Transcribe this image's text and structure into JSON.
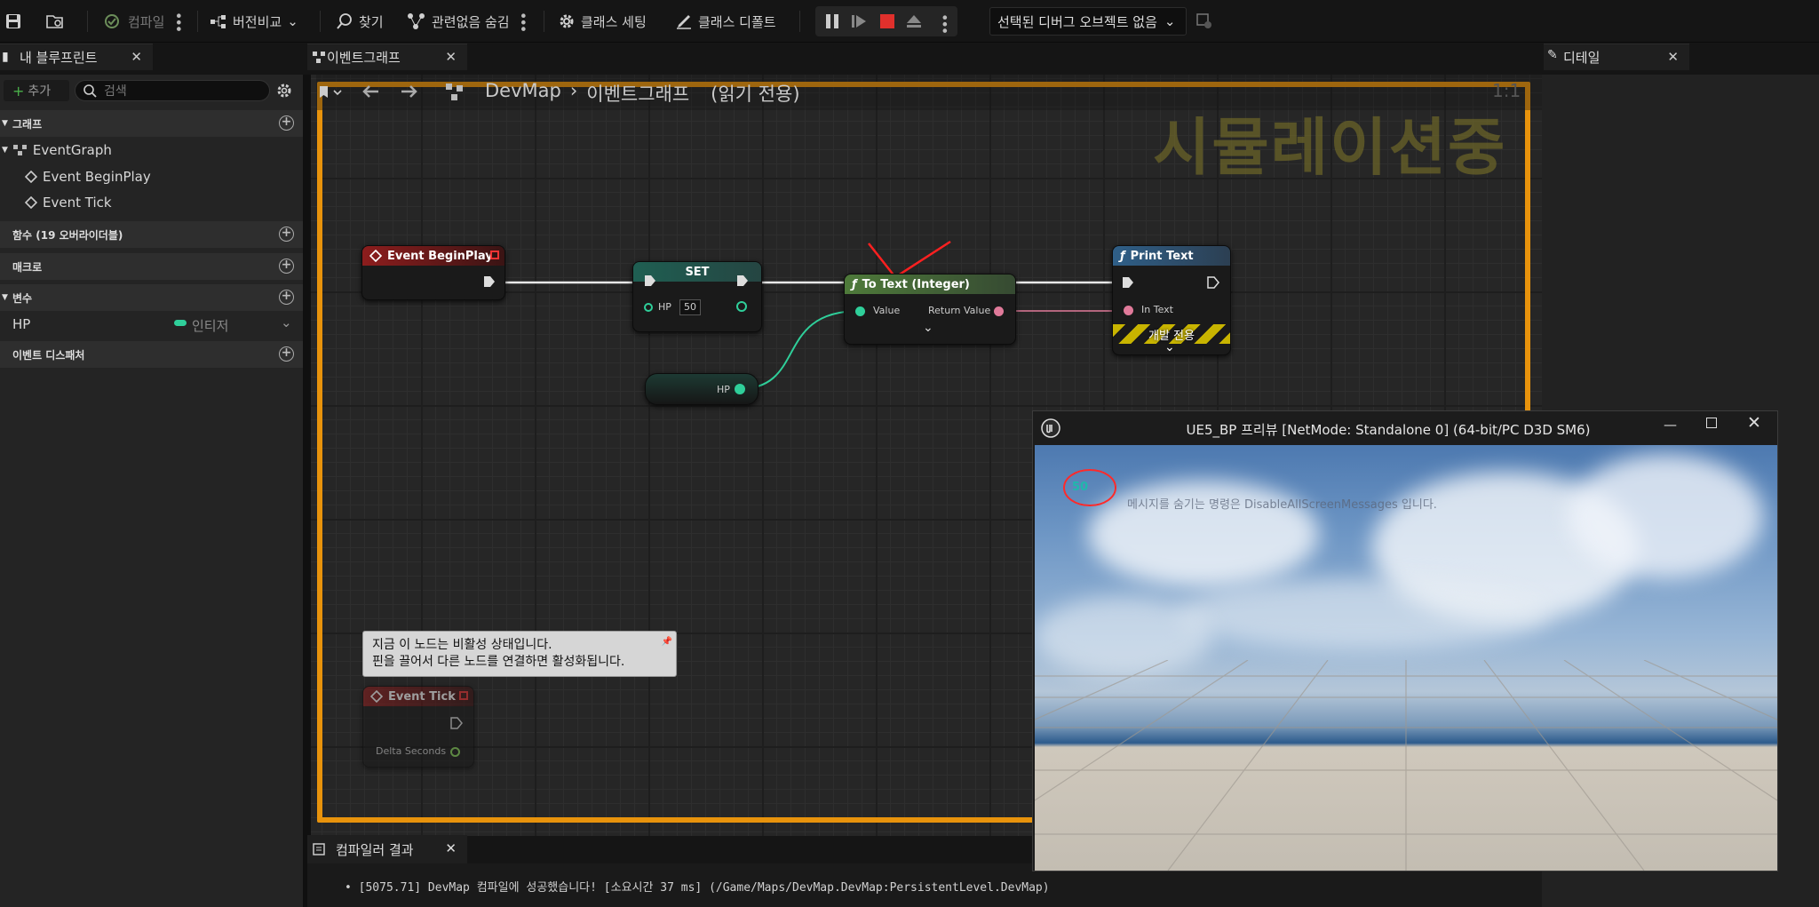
{
  "toolbar": {
    "compile": "컴파일",
    "diff": "버전비교",
    "find": "찾기",
    "hide_unrelated": "관련없음 숨김",
    "class_settings": "클래스 세팅",
    "class_defaults": "클래스 디폴트",
    "debug_object": "선택된 디버그 오브젝트 없음"
  },
  "my_blueprint": {
    "tab": "내 블루프린트",
    "add": "추가",
    "search_placeholder": "검색",
    "sections": {
      "graphs": "그래프",
      "functions": "함수 (19 오버라이더블)",
      "macros": "매크로",
      "variables": "변수",
      "dispatchers": "이벤트 디스패처"
    },
    "graph_items": [
      "EventGraph",
      "Event BeginPlay",
      "Event Tick"
    ],
    "variable": {
      "name": "HP",
      "type": "인티저"
    }
  },
  "graph": {
    "tab": "이벤트그래프",
    "breadcrumb_map": "DevMap",
    "breadcrumb_graph": "이벤트그래프",
    "readonly": "(읽기 전용)",
    "simulating": "시뮬레이션중",
    "zoom": "1:1",
    "nodes": {
      "begin_play": "Event BeginPlay",
      "set": "SET",
      "set_pin": "HP",
      "set_value": "50",
      "get_hp": "HP",
      "to_text": "To Text (Integer)",
      "to_text_in": "Value",
      "to_text_out": "Return Value",
      "print_text": "Print Text",
      "print_in": "In Text",
      "dev_only": "개발 전용",
      "event_tick": "Event Tick",
      "delta": "Delta Seconds"
    },
    "comment_line1": "지금 이 노드는 비활성 상태입니다.",
    "comment_line2": "핀을 끌어서 다른 노드를 연결하면 활성화됩니다."
  },
  "details": {
    "tab": "디테일"
  },
  "compiler": {
    "tab": "컴파일러 결과",
    "message": "[5075.71] DevMap 컴파일에 성공했습니다! [소요시간 37 ms] (/Game/Maps/DevMap.DevMap:PersistentLevel.DevMap)"
  },
  "preview": {
    "title": "UE5_BP 프리뷰 [NetMode: Standalone 0]  (64-bit/PC D3D SM6)",
    "printed_value": "50",
    "hint": "메시지를 숨기는 명령은 DisableAllScreenMessages 입니다."
  },
  "colors": {
    "simulate_border": "#e8930c",
    "event_head": "#8d1d1d",
    "set_head": "#1f5f52",
    "func_green": "#4e7a3a",
    "func_blue": "#2f5f88",
    "int_pin": "#2fcf9a",
    "text_pin": "#e07a9a"
  }
}
